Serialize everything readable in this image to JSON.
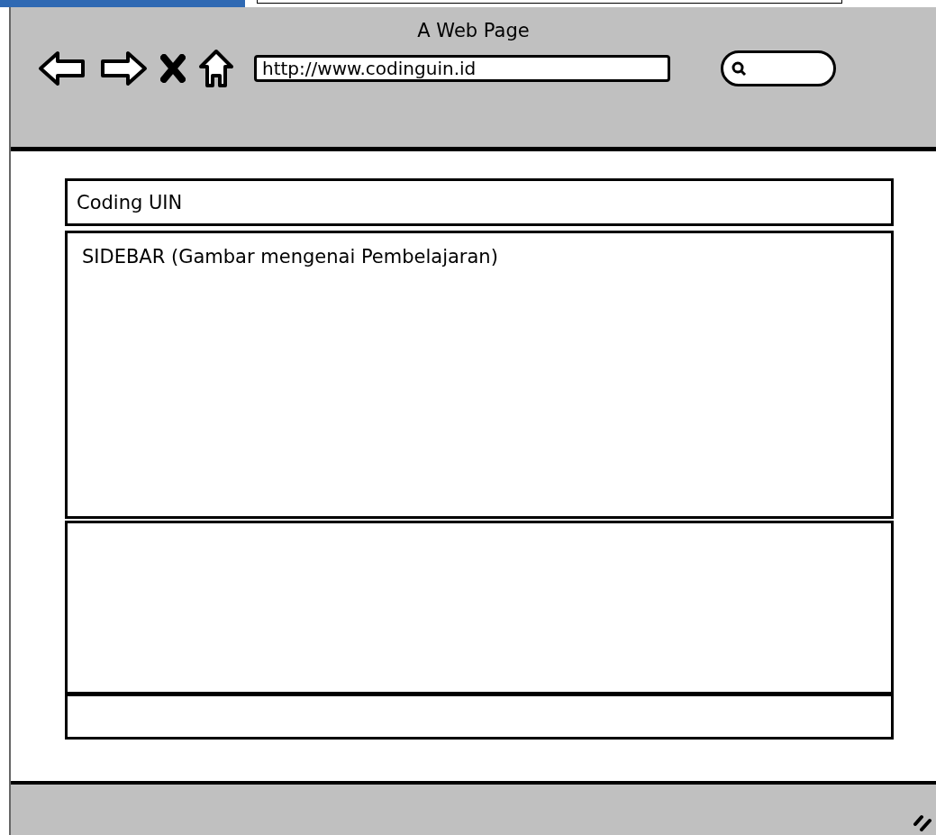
{
  "window": {
    "title": "A Web Page"
  },
  "address_bar": {
    "value": "http://www.codinguin.id"
  },
  "page": {
    "header": "Coding UIN",
    "sidebar": "SIDEBAR (Gambar mengenai Pembelajaran)"
  }
}
